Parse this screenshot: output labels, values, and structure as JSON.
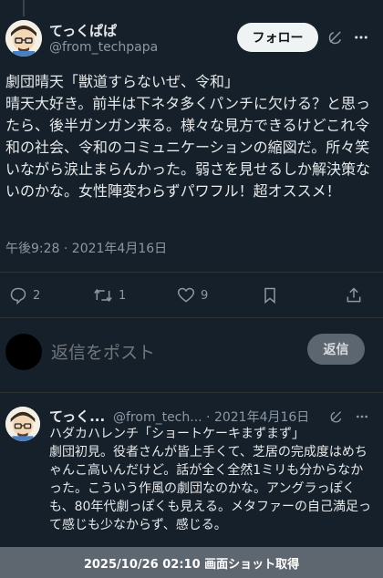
{
  "tweet": {
    "author_name": "てっくぱぱ",
    "author_handle": "@from_techpapa",
    "follow_label": "フォロー",
    "text": "劇団晴天「獣道すらないぜ、令和」\n晴天大好き。前半は下ネタ多くパンチに欠ける？と思ったら、後半ガンガン来る。様々な見方できるけどこれ令和の社会、令和のコミュニケーションの縮図だ。所々笑いながら涙止まらんかった。弱さを見せるしか解決策ないのかな。女性陣変わらずパワフル！超オススメ！",
    "timestamp": "午後9:28 · 2021年4月16日",
    "actions": {
      "reply_count": "2",
      "retweet_count": "1",
      "like_count": "9"
    }
  },
  "reply_box": {
    "placeholder": "返信をポスト",
    "button_label": "返信"
  },
  "next_post": {
    "author_name": "てっく...",
    "meta": "@from_tech... · 2021年4月16日",
    "text": "ハダカハレンチ「ショートケーキまずまず」\n劇団初見。役者さんが皆上手くて、芝居の完成度はめちゃんこ高いんだけど。話が全く全然1ミリも分からなかった。こういう作風の劇団なのかな。アングラっぽくも、80年代劇っぽくも見える。メタファーの自己満足って感じも少なからず、感じる。"
  },
  "footer": {
    "text": "2025/10/26 02:10 画面ショット取得"
  },
  "colors": {
    "background": "#15202b",
    "text": "#e7e9ea",
    "muted": "#8b98a5",
    "follow_bg": "#eff3f4",
    "reply_btn_bg": "#5c6670",
    "footer_bg": "#5e6670"
  }
}
